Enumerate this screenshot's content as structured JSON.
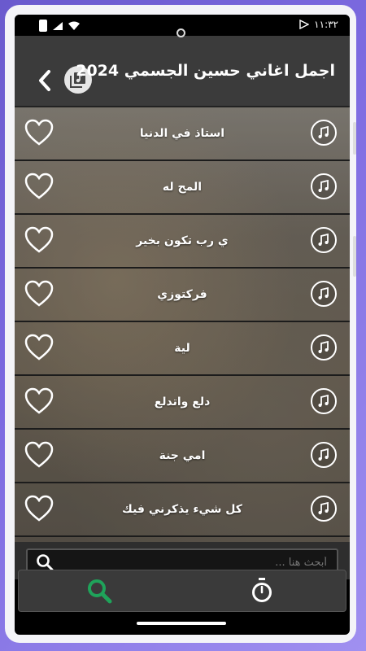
{
  "status_bar": {
    "time": "١١:٣٢"
  },
  "app_bar": {
    "title": "اجمل اغاني حسين الجسمي 2024"
  },
  "songs": [
    {
      "title": "استاذ في الدنيا"
    },
    {
      "title": "المح له"
    },
    {
      "title": "ي رب تكون بخير"
    },
    {
      "title": "فركتوزي"
    },
    {
      "title": "لية"
    },
    {
      "title": "دلع واتدلع"
    },
    {
      "title": "امي جنة"
    },
    {
      "title": "كل شيء يذكرني فيك"
    }
  ],
  "search": {
    "placeholder": "أبحث هنا ..."
  },
  "bottom_nav": {
    "items": [
      {
        "icon": "timer-icon"
      },
      {
        "icon": "search-icon"
      }
    ]
  },
  "colors": {
    "accent_green": "#1fa35a",
    "app_bar": "#3b3b3b"
  }
}
